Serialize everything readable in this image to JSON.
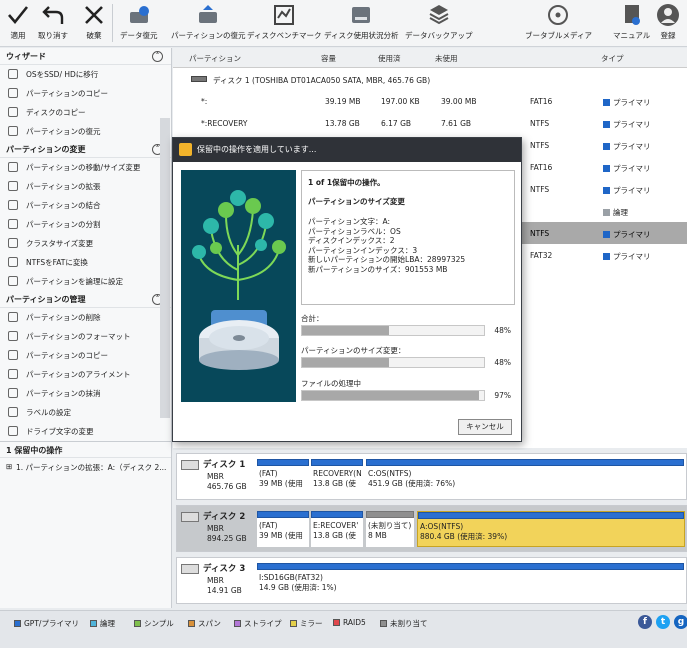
{
  "toolbar": {
    "apply": "適用",
    "undo": "取り消す",
    "discard": "破棄",
    "data_recovery": "データ復元",
    "partition_recovery": "パーティションの復元",
    "disk_benchmark": "ディスクベンチマーク",
    "space_analyzer": "ディスク使用状況分析",
    "data_backup": "データバックアップ",
    "bootable_media": "ブータブルメディア",
    "manual": "マニュアル",
    "register": "登録"
  },
  "sidebar": {
    "wizard": {
      "title": "ウィザード",
      "items": [
        "OSをSSD/ HDに移行",
        "パーティションのコピー",
        "ディスクのコピー",
        "パーティションの復元"
      ]
    },
    "change_partition": {
      "title": "パーティションの変更",
      "items": [
        "パーティションの移動/サイズ変更",
        "パーティションの拡張",
        "パーティションの結合",
        "パーティションの分割",
        "クラスタサイズ変更",
        "NTFSをFATに変換",
        "パーティションを論理に設定"
      ]
    },
    "manage_partition": {
      "title": "パーティションの管理",
      "items": [
        "パーティションの削除",
        "パーティションのフォーマット",
        "パーティションのコピー",
        "パーティションのアライメント",
        "パーティションの抹消",
        "ラベルの設定",
        "ドライブ文字の変更"
      ]
    },
    "pending": {
      "title": "1 保留中の操作",
      "item": "1. パーティションの拡張：A:（ディスク 2..."
    }
  },
  "table": {
    "headers": {
      "partition": "パーティション",
      "capacity": "容量",
      "used": "使用済",
      "unused": "未使用",
      "type": "タイプ"
    },
    "disk1_label": "ディスク 1 (TOSHIBA DT01ACA050 SATA, MBR, 465.76 GB)",
    "rows": [
      {
        "name": "*:",
        "capacity": "39.19 MB",
        "used": "197.00 KB",
        "unused": "39.00 MB",
        "fs": "FAT16",
        "type": "プライマリ"
      },
      {
        "name": "*:RECOVERY",
        "capacity": "13.78 GB",
        "used": "6.17 GB",
        "unused": "7.61 GB",
        "fs": "NTFS",
        "type": "プライマリ"
      },
      {
        "name": "",
        "capacity": "",
        "used": "",
        "unused": "",
        "fs": "NTFS",
        "type": "プライマリ"
      },
      {
        "name": "",
        "capacity": "",
        "used": "",
        "unused": "",
        "fs": "FAT16",
        "type": "プライマリ"
      },
      {
        "name": "",
        "capacity": "",
        "used": "",
        "unused": "",
        "fs": "NTFS",
        "type": "プライマリ"
      },
      {
        "name": "",
        "capacity": "",
        "used": "",
        "unused": "未割り当て",
        "fs": "",
        "type": "論理"
      },
      {
        "name": "",
        "capacity": "",
        "used": "",
        "unused": "",
        "fs": "NTFS",
        "type": "プライマリ"
      },
      {
        "name": "",
        "capacity": "",
        "used": "",
        "unused": "",
        "fs": "FAT32",
        "type": "プライマリ"
      }
    ]
  },
  "dialog": {
    "title": "保留中の操作を適用しています...",
    "op_count": "1 of 1保留中の操作。",
    "op_name": "パーティションのサイズ変更",
    "details": [
      "パーティション文字：A:",
      "パーティションラベル：OS",
      "ディスクインデックス：2",
      "パーティションインデックス：3",
      "新しいパーティションの開始LBA：28997325",
      "新パーティションのサイズ：901553 MB"
    ],
    "total_label": "合計：",
    "total_pct": "48%",
    "total_value": 48,
    "resize_label": "パーティションのサイズ変更：",
    "resize_pct": "48%",
    "resize_value": 48,
    "file_label": "ファイルの処理中",
    "file_pct": "97%",
    "file_value": 97,
    "cancel": "キャンセル"
  },
  "diskmap": {
    "disk1": {
      "name": "ディスク 1",
      "scheme": "MBR",
      "size": "465.76 GB",
      "parts": [
        {
          "l1": "(FAT)",
          "l2": "39 MB (使用"
        },
        {
          "l1": "RECOVERY(N",
          "l2": "13.8 GB (使"
        },
        {
          "l1": "C:OS(NTFS)",
          "l2": "451.9 GB (使用済: 76%)"
        }
      ]
    },
    "disk2": {
      "name": "ディスク 2",
      "scheme": "MBR",
      "size": "894.25 GB",
      "parts": [
        {
          "l1": "(FAT)",
          "l2": "39 MB (使用"
        },
        {
          "l1": "E:RECOVER'",
          "l2": "13.8 GB (使"
        },
        {
          "l1": "(未割り当て)",
          "l2": "8 MB"
        },
        {
          "l1": "A:OS(NTFS)",
          "l2": "880.4 GB (使用済: 39%)"
        }
      ]
    },
    "disk3": {
      "name": "ディスク 3",
      "scheme": "MBR",
      "size": "14.91 GB",
      "parts": [
        {
          "l1": "I:SD16GB(FAT32)",
          "l2": "14.9 GB (使用済: 1%)"
        }
      ]
    }
  },
  "legend": [
    "GPT/プライマリ",
    "論理",
    "シンプル",
    "スパン",
    "ストライプ",
    "ミラー",
    "RAID5",
    "未割り当て"
  ],
  "legend_colors": [
    "#2a6fd0",
    "#4fb3d9",
    "#7fbf4d",
    "#d9913a",
    "#b277d6",
    "#e3cf4a",
    "#e0474c",
    "#8f8f8f"
  ]
}
